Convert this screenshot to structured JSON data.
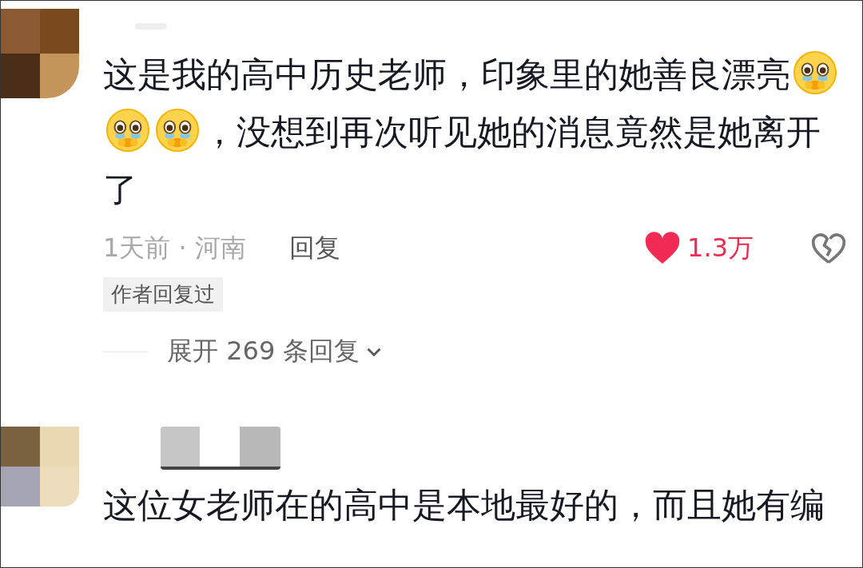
{
  "comments": [
    {
      "body": [
        {
          "kind": "text",
          "text": "这是我的高中历史老师，印象里的她善良漂亮"
        },
        {
          "kind": "emoji"
        },
        {
          "kind": "emoji"
        },
        {
          "kind": "emoji"
        },
        {
          "kind": "text",
          "text": "，没想到再次听见她的消息竟然是她离开了"
        }
      ],
      "time": "1天前",
      "separator": "·",
      "location": "河南",
      "reply_label": "回复",
      "liked": true,
      "likes": "1.3万",
      "tag": "作者回复过",
      "expand_label": "展开 269 条回复"
    },
    {
      "body": [
        {
          "kind": "text",
          "text": "这位女老师在的高中是本地最好的，而且她有编"
        }
      ]
    }
  ]
}
